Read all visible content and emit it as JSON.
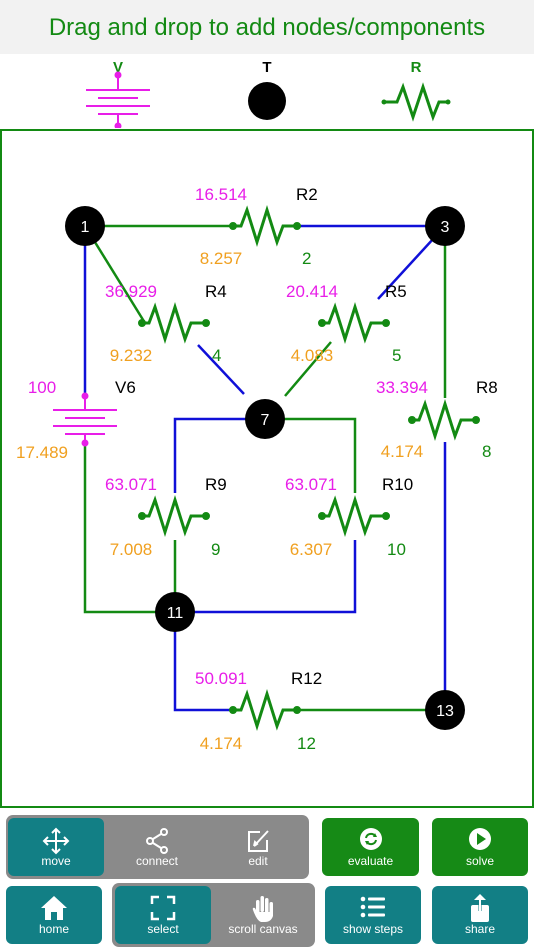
{
  "header": {
    "title": "Drag and drop to add nodes/components"
  },
  "palette": {
    "items": [
      {
        "label": "V",
        "icon": "battery-icon"
      },
      {
        "label": "T",
        "icon": "terminal-node-icon"
      },
      {
        "label": "R",
        "icon": "resistor-icon"
      }
    ]
  },
  "colors": {
    "green": "#138a13",
    "blue": "#1010d8",
    "magenta": "#e81ee8",
    "orange": "#f0a020",
    "teal": "#127f85",
    "grey": "#8a8a8a"
  },
  "circuit": {
    "nodes": [
      {
        "label": "1"
      },
      {
        "label": "3"
      },
      {
        "label": "7"
      },
      {
        "label": "11"
      },
      {
        "label": "13"
      }
    ],
    "components": [
      {
        "name": "R2",
        "top_value": "16.514",
        "bottom_value": "8.257",
        "index": "2"
      },
      {
        "name": "R4",
        "top_value": "36.929",
        "bottom_value": "9.232",
        "index": "4"
      },
      {
        "name": "R5",
        "top_value": "20.414",
        "bottom_value": "4.083",
        "index": "5"
      },
      {
        "name": "V6",
        "top_value": "100",
        "bottom_value": "17.489",
        "index": ""
      },
      {
        "name": "R8",
        "top_value": "33.394",
        "bottom_value": "4.174",
        "index": "8"
      },
      {
        "name": "R9",
        "top_value": "63.071",
        "bottom_value": "7.008",
        "index": "9"
      },
      {
        "name": "R10",
        "top_value": "63.071",
        "bottom_value": "6.307",
        "index": "10"
      },
      {
        "name": "R12",
        "top_value": "50.091",
        "bottom_value": "4.174",
        "index": "12"
      }
    ]
  },
  "toolbar": {
    "move": "move",
    "connect": "connect",
    "edit": "edit",
    "evaluate": "evaluate",
    "solve": "solve",
    "home": "home",
    "select": "select",
    "scroll_canvas": "scroll canvas",
    "show_steps": "show steps",
    "share": "share"
  }
}
